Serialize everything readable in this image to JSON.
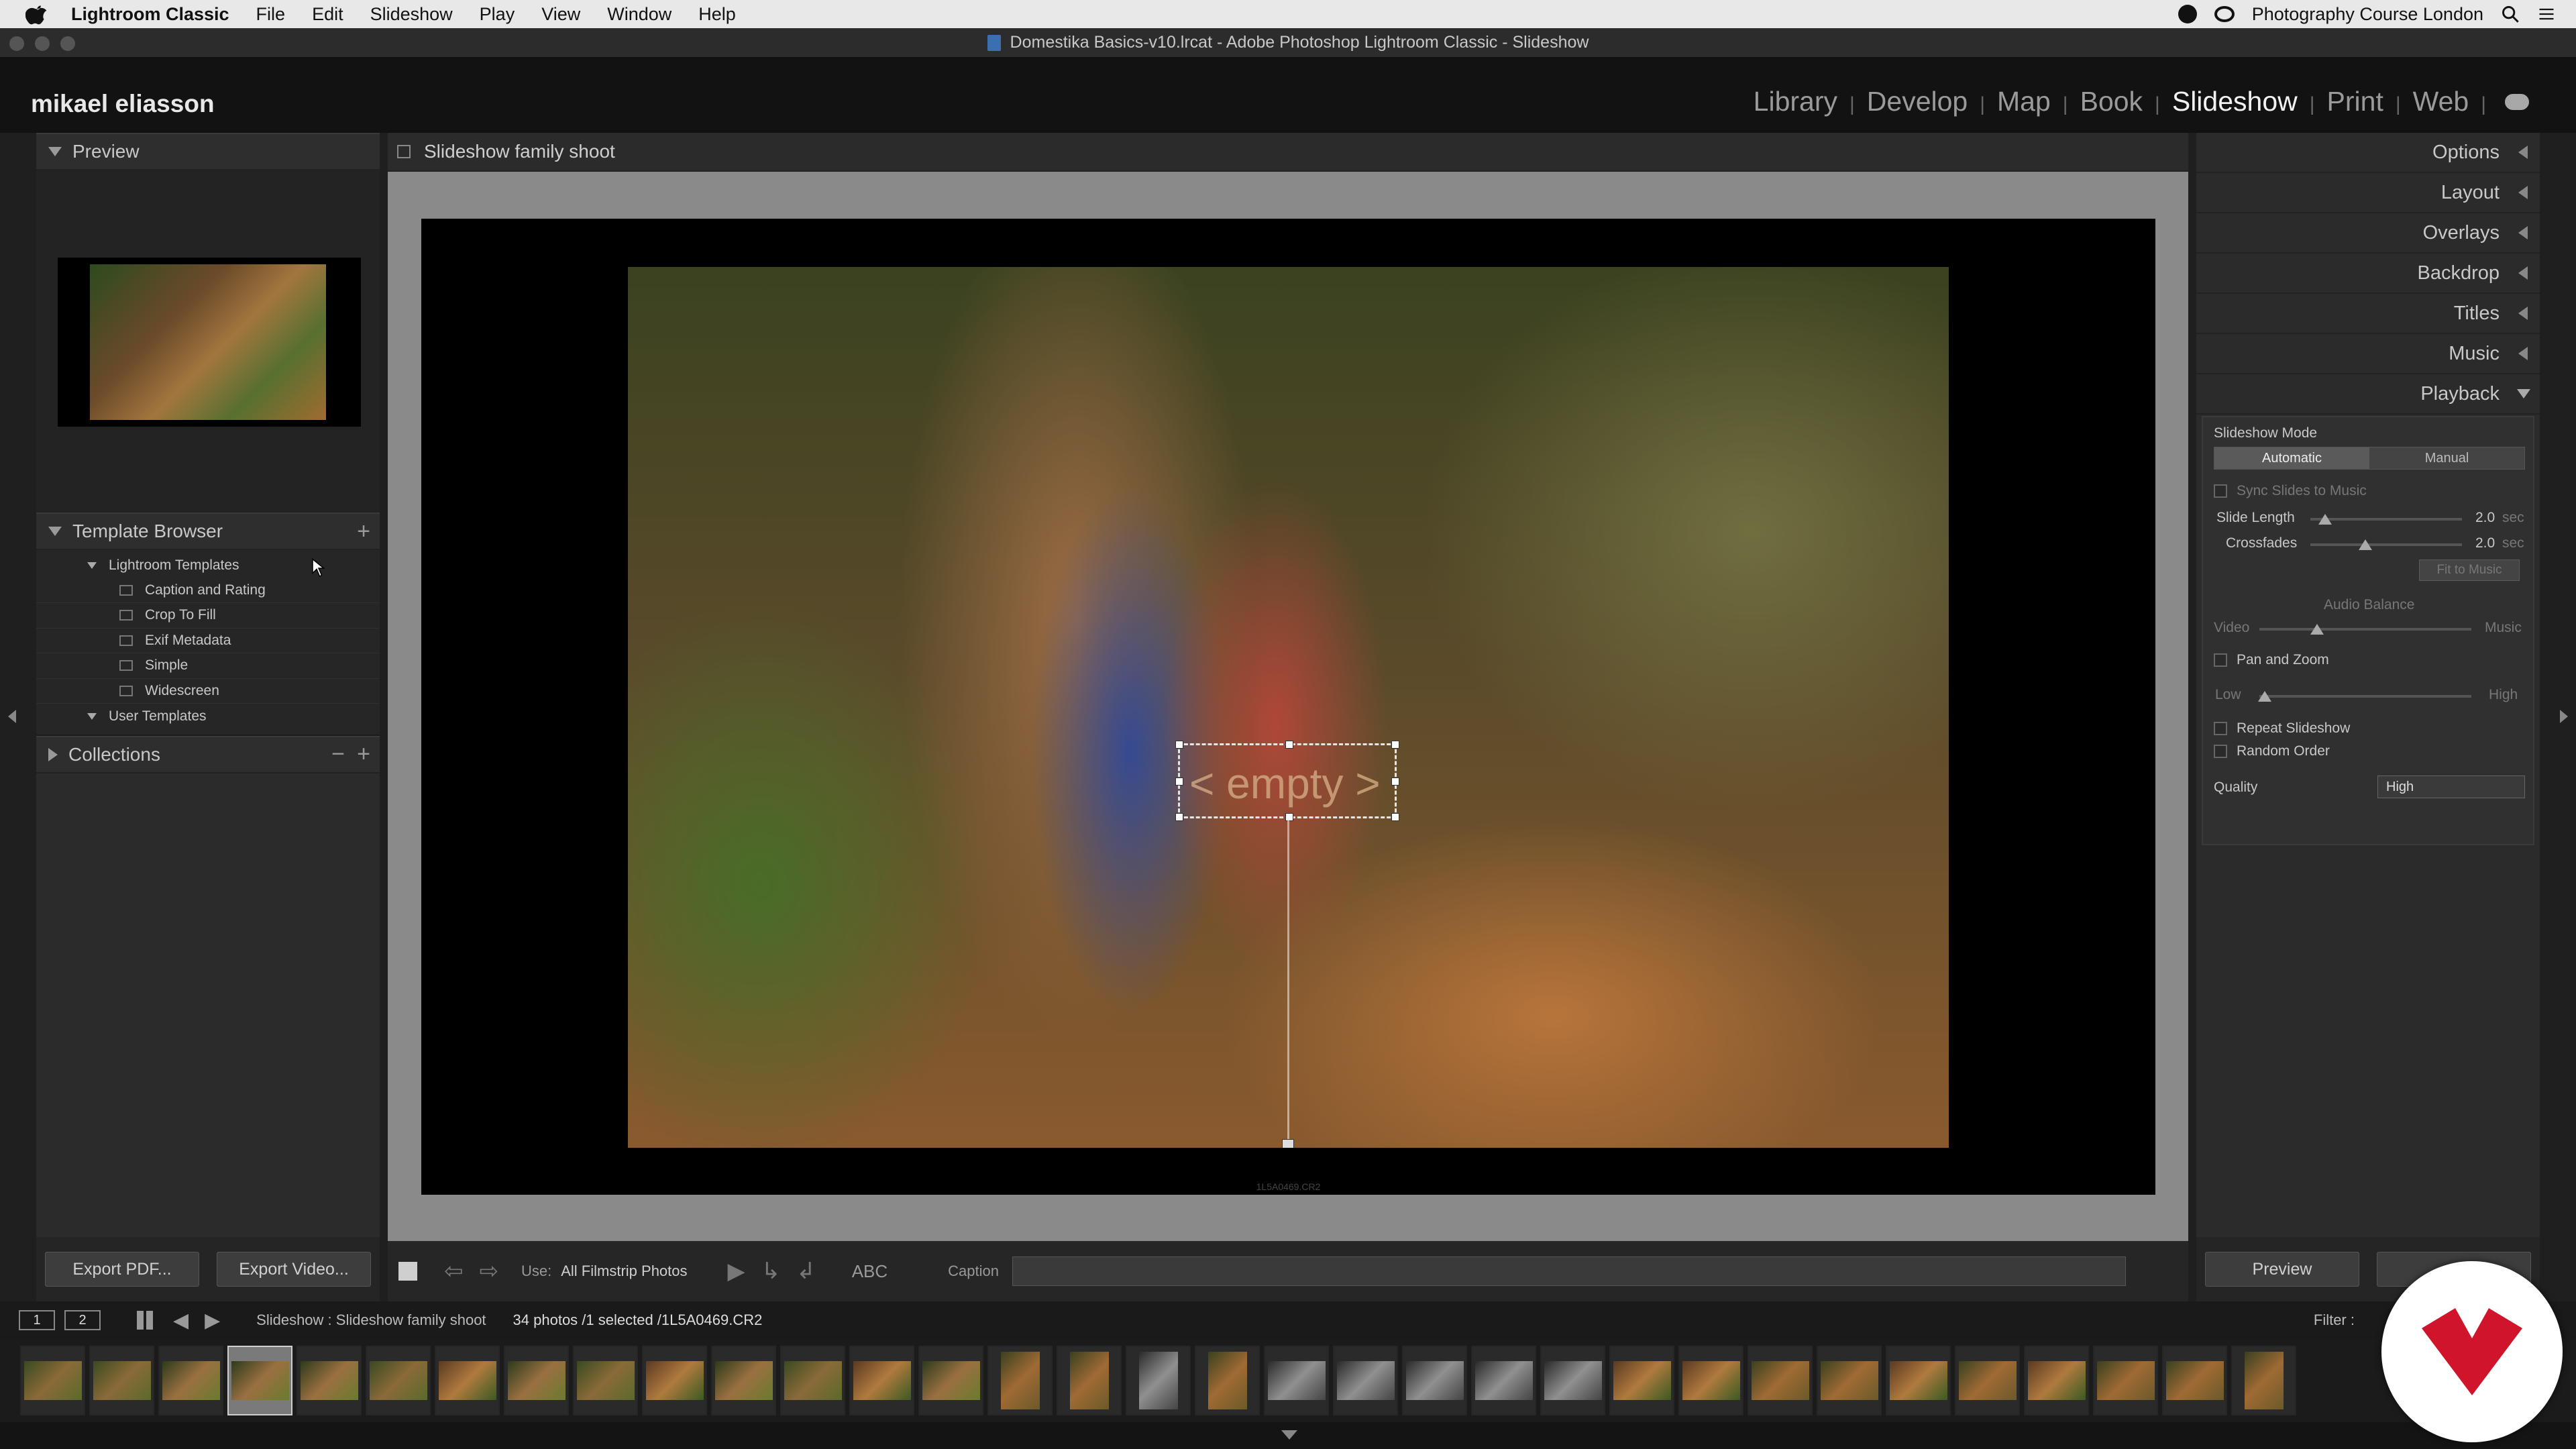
{
  "menubar": {
    "app_name": "Lightroom Classic",
    "items": [
      "File",
      "Edit",
      "Slideshow",
      "Play",
      "View",
      "Window",
      "Help"
    ],
    "right_label": "Photography Course London"
  },
  "window": {
    "title": "Domestika Basics-v10.lrcat - Adobe Photoshop Lightroom Classic - Slideshow"
  },
  "identity_plate": "mikael eliasson",
  "modules": [
    {
      "label": "Library",
      "active": false
    },
    {
      "label": "Develop",
      "active": false
    },
    {
      "label": "Map",
      "active": false
    },
    {
      "label": "Book",
      "active": false
    },
    {
      "label": "Slideshow",
      "active": true
    },
    {
      "label": "Print",
      "active": false
    },
    {
      "label": "Web",
      "active": false
    }
  ],
  "left_panel": {
    "preview_title": "Preview",
    "template_browser_title": "Template Browser",
    "lightroom_templates_label": "Lightroom Templates",
    "templates": [
      "Caption and Rating",
      "Crop To Fill",
      "Exif Metadata",
      "Simple",
      "Widescreen"
    ],
    "user_templates_label": "User Templates",
    "collections_title": "Collections",
    "export_pdf": "Export PDF...",
    "export_video": "Export Video..."
  },
  "center": {
    "title": "Slideshow family shoot",
    "caption_placeholder": "< empty >",
    "filename_tag": "1L5A0469.CR2",
    "toolbar": {
      "use_label": "Use:",
      "use_value": "All Filmstrip Photos",
      "abc": "ABC",
      "caption_label": "Caption"
    }
  },
  "right_panel": {
    "sections": [
      "Options",
      "Layout",
      "Overlays",
      "Backdrop",
      "Titles",
      "Music"
    ],
    "playback_title": "Playback",
    "playback": {
      "mode_label": "Slideshow Mode",
      "mode_options": [
        "Automatic",
        "Manual"
      ],
      "sync_label": "Sync Slides to Music",
      "slide_length_label": "Slide Length",
      "slide_length_value": "2.0",
      "crossfades_label": "Crossfades",
      "crossfades_value": "2.0",
      "unit": "sec",
      "fit_to_music": "Fit to Music",
      "audio_balance_label": "Audio Balance",
      "video_label": "Video",
      "music_label": "Music",
      "pan_zoom_label": "Pan and Zoom",
      "low_label": "Low",
      "high_label": "High",
      "repeat_label": "Repeat Slideshow",
      "random_label": "Random Order",
      "quality_label": "Quality",
      "quality_value": "High"
    },
    "preview_button": "Preview"
  },
  "filmstrip": {
    "monitor_1": "1",
    "monitor_2": "2",
    "path": "Slideshow : Slideshow family shoot",
    "count": "34 photos /1 selected /1L5A0469.CR2",
    "filter_label": "Filter :"
  },
  "colors": {
    "accent": "#f2f2f2",
    "panel": "#2b2b2b",
    "stage": "#8a8a8a",
    "logo_red": "#d0142c"
  }
}
